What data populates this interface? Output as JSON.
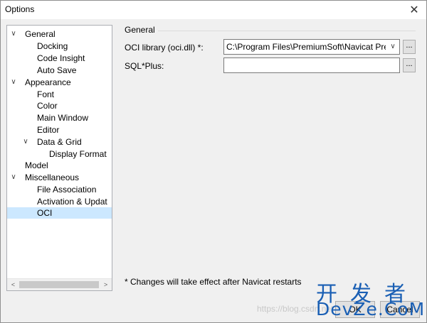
{
  "window": {
    "title": "Options",
    "close_glyph": "✕"
  },
  "tree": {
    "items": [
      {
        "label": "General",
        "expanded": true,
        "toggle": "∨"
      },
      {
        "label": "Docking"
      },
      {
        "label": "Code Insight"
      },
      {
        "label": "Auto Save"
      },
      {
        "label": "Appearance",
        "expanded": true,
        "toggle": "∨"
      },
      {
        "label": "Font"
      },
      {
        "label": "Color"
      },
      {
        "label": "Main Window"
      },
      {
        "label": "Editor"
      },
      {
        "label": "Data & Grid",
        "expanded": true,
        "toggle": "∨"
      },
      {
        "label": "Display Format"
      },
      {
        "label": "Model"
      },
      {
        "label": "Miscellaneous",
        "expanded": true,
        "toggle": "∨"
      },
      {
        "label": "File Association"
      },
      {
        "label": "Activation & Updat"
      },
      {
        "label": "OCI",
        "selected": true
      }
    ],
    "scroll_left": "<",
    "scroll_right": ">"
  },
  "general": {
    "group_title": "General",
    "oci_label": "OCI library (oci.dll) *:",
    "oci_value": "C:\\Program Files\\PremiumSoft\\Navicat Pre",
    "oci_arrow": "∨",
    "sqlplus_label": "SQL*Plus:",
    "sqlplus_value": "",
    "browse_label": "...",
    "note": "* Changes will take effect after Navicat restarts"
  },
  "buttons": {
    "ok_label": "OK",
    "cancel_label": "Cancel"
  },
  "overlay": {
    "watermark": "https://blog.csdn.net",
    "logo_top": "开发者",
    "logo_bottom": "DevZe.CoM"
  },
  "colors": {
    "selection": "#cce8ff",
    "logo": "#1a5fb4"
  }
}
